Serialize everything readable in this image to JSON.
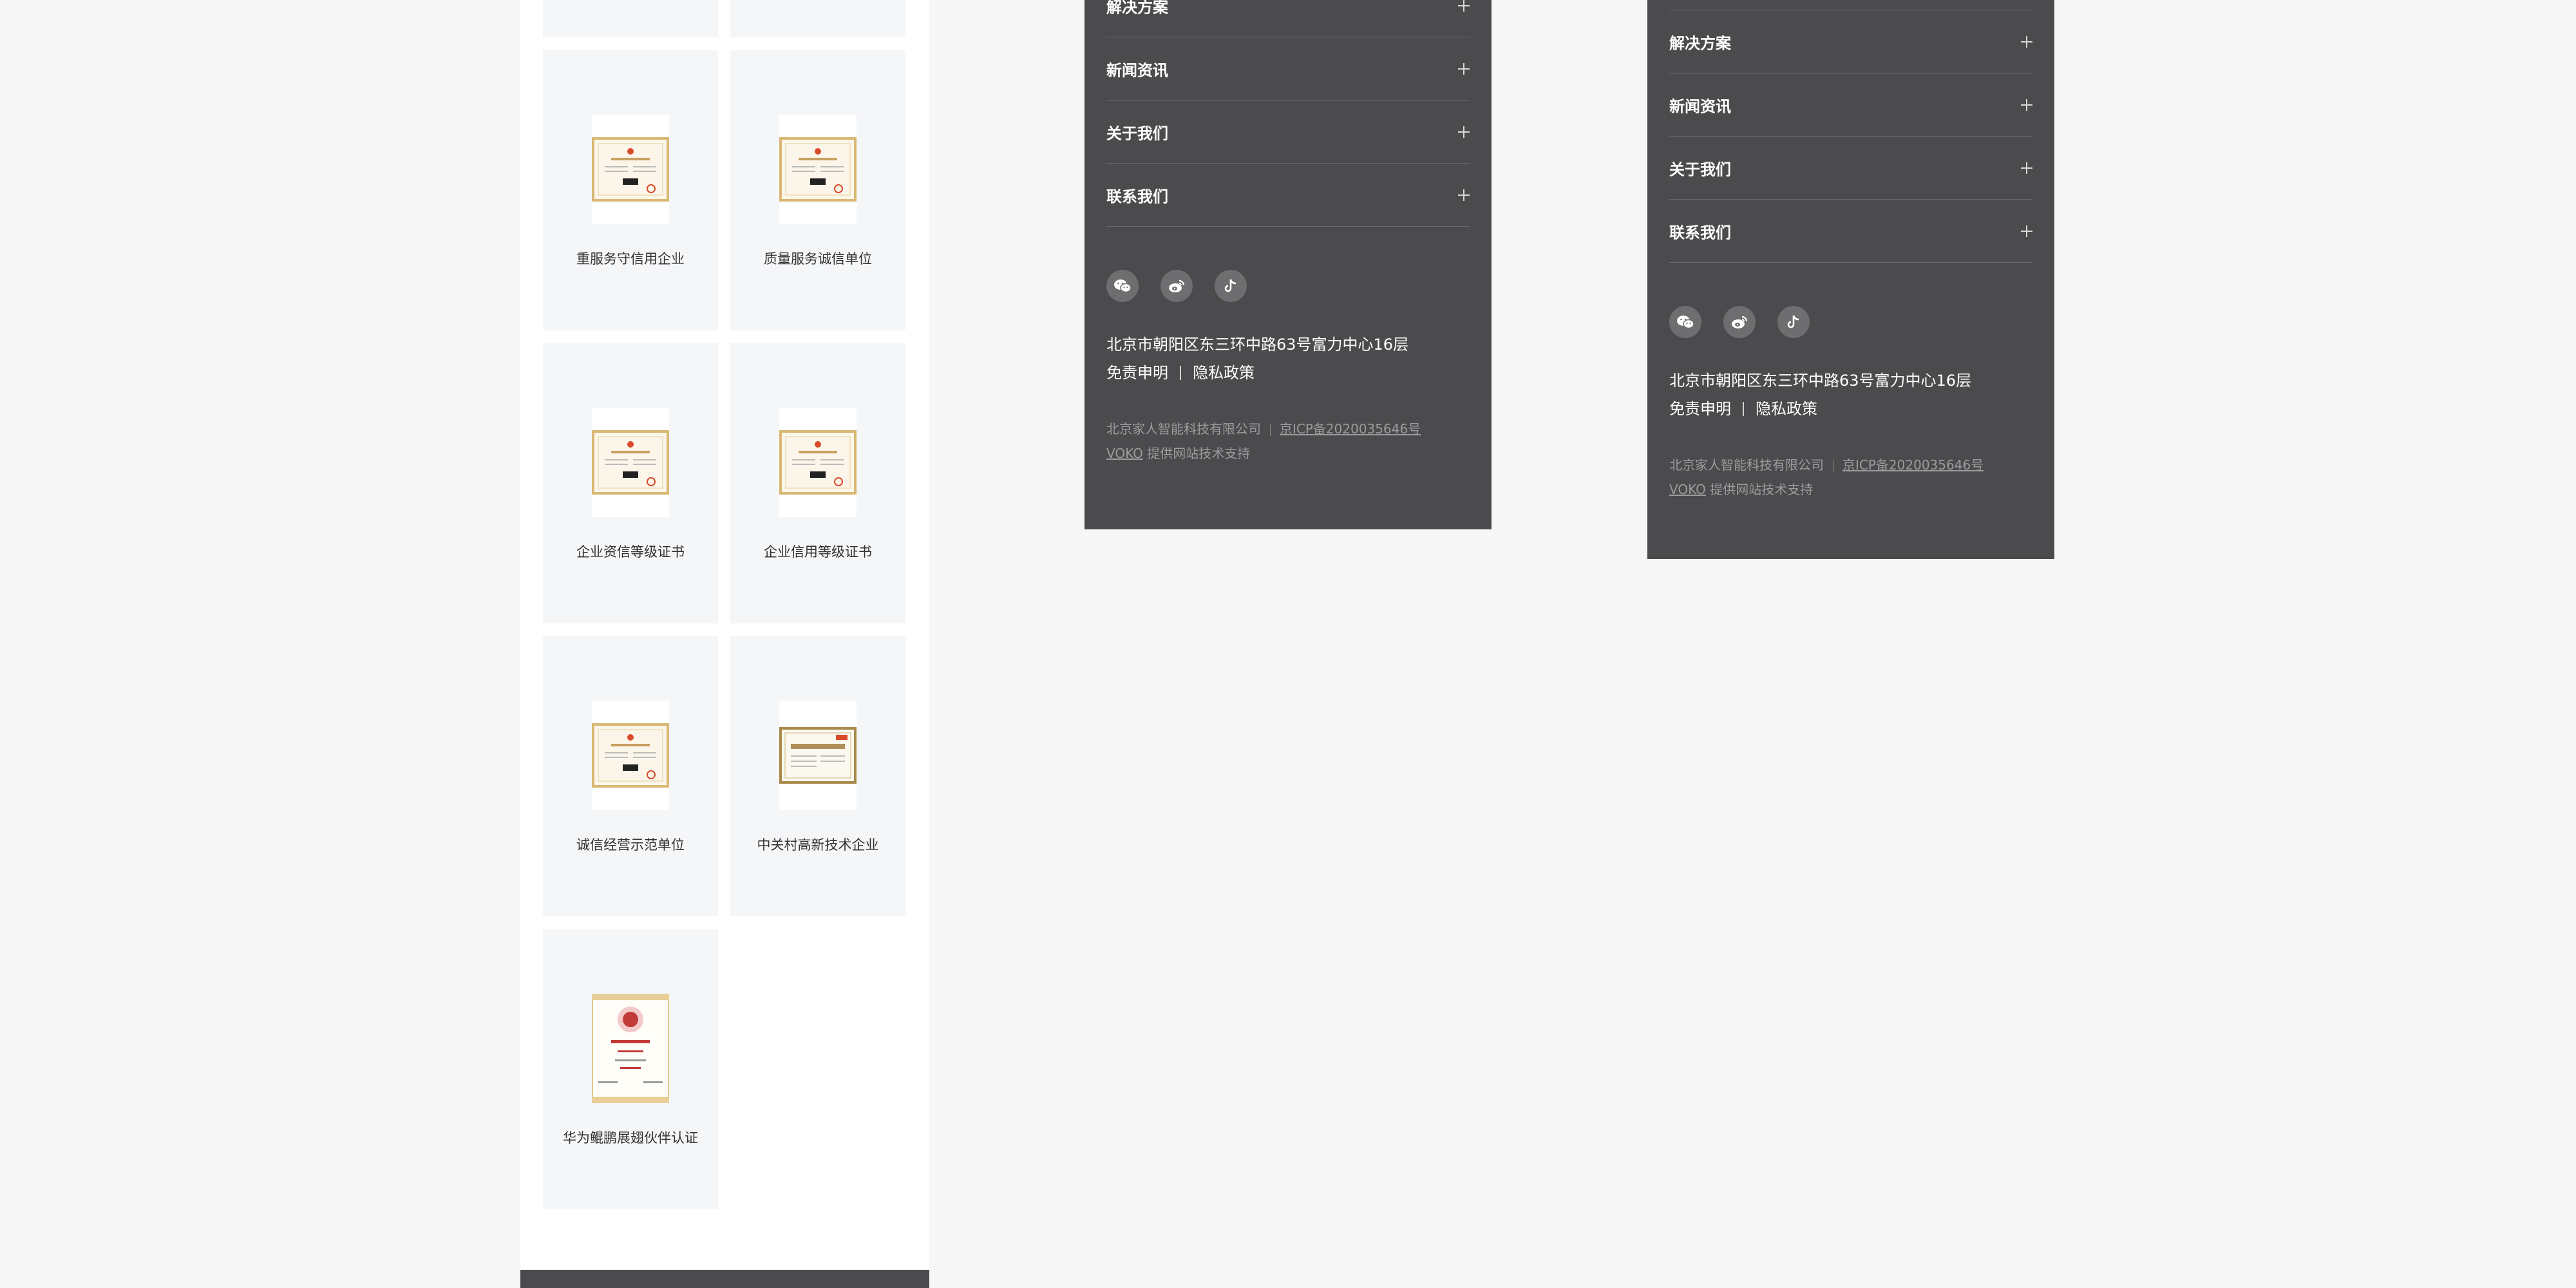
{
  "certificates": [
    {
      "title": "重服务守信用企业",
      "icon": "certificate-portrait"
    },
    {
      "title": "质量服务诚信单位",
      "icon": "certificate-portrait"
    },
    {
      "title": "企业资信等级证书",
      "icon": "certificate-portrait"
    },
    {
      "title": "企业信用等级证书",
      "icon": "certificate-portrait"
    },
    {
      "title": "诚信经营示范单位",
      "icon": "certificate-portrait"
    },
    {
      "title": "中关村高新技术企业",
      "icon": "certificate-landscape"
    },
    {
      "title": "华为鲲鹏展翅伙伴认证",
      "icon": "certificate-seal"
    }
  ],
  "footer": {
    "menu": [
      "解决方案",
      "新闻资讯",
      "关于我们",
      "联系我们"
    ],
    "social_icons": [
      "wechat-icon",
      "weibo-icon",
      "douyin-icon"
    ],
    "address": "北京市朝阳区东三环中路63号富力中心16层",
    "disclaimer": "免责申明",
    "privacy": "隐私政策",
    "company": "北京家人智能科技有限公司",
    "icp": "京ICP备2020035646号",
    "voko": "VOKO",
    "support": "提供网站技术支持"
  },
  "colors": {
    "footer_bg": "#4b4b4d",
    "page_bg": "#f6f6f6",
    "card_bg": "#f5f6f8"
  }
}
